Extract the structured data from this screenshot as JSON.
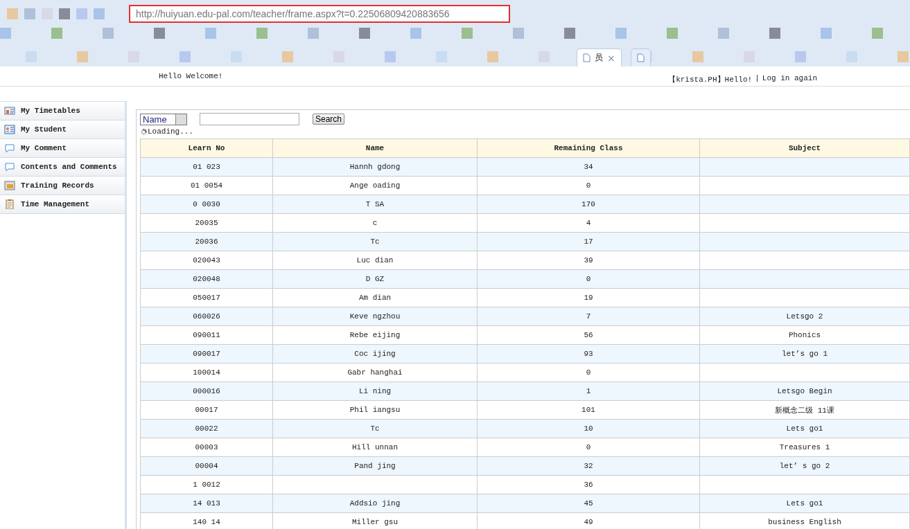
{
  "browser": {
    "address": "http://huiyuan.edu-pal.com/teacher/frame.aspx?t=0.22506809420883656",
    "tabs": [
      {
        "label": "员",
        "close": "×",
        "selected": true
      },
      {
        "selected": false
      }
    ]
  },
  "header": {
    "welcome": "Hello Welcome!",
    "user": "【krista.PH】Hello!",
    "separator": "|",
    "logout": "Log in again"
  },
  "sidebar": {
    "items": [
      {
        "label": "My Timetables",
        "kind": "timetable"
      },
      {
        "label": "My Student",
        "kind": "card"
      },
      {
        "label": "My Comment",
        "kind": "bubble"
      },
      {
        "label": "Contents and Comments",
        "kind": "bubble"
      },
      {
        "label": "Training Records",
        "kind": "records"
      },
      {
        "label": "Time Management",
        "kind": "clipboard"
      }
    ]
  },
  "search": {
    "field": "Name",
    "button": "Search",
    "status": "Loading..."
  },
  "table": {
    "columns": [
      "Learn No",
      "Name",
      "Remaining Class",
      "Subject"
    ],
    "rows": [
      [
        "01 023",
        "Hannh gdong",
        "34",
        ""
      ],
      [
        "01 0054",
        "Ange oading",
        "0",
        ""
      ],
      [
        "0 0030",
        "T SA",
        "170",
        ""
      ],
      [
        "20035",
        "c",
        "4",
        ""
      ],
      [
        "20036",
        "Tc",
        "17",
        ""
      ],
      [
        "020043",
        "Luc dian",
        "39",
        ""
      ],
      [
        "020048",
        "D GZ",
        "0",
        ""
      ],
      [
        "050017",
        "Am dian",
        "19",
        ""
      ],
      [
        "060026",
        "Keve ngzhou",
        "7",
        "Letsgo 2"
      ],
      [
        "090011",
        "Rebe eijing",
        "56",
        "Phonics"
      ],
      [
        "090017",
        "Coc ijing",
        "93",
        "let’s go 1"
      ],
      [
        "100014",
        "Gabr hanghai",
        "0",
        ""
      ],
      [
        "000016",
        "Li ning",
        "1",
        "Letsgo Begin"
      ],
      [
        "00017",
        "Phil iangsu",
        "101",
        "新概念二级 11课"
      ],
      [
        "00022",
        "Tc",
        "10",
        "Lets go1"
      ],
      [
        "00003",
        "Hill unnan",
        "0",
        "Treasures 1"
      ],
      [
        "00004",
        "Pand jing",
        "32",
        "let’ s go 2"
      ],
      [
        "1 0012",
        "",
        "36",
        ""
      ],
      [
        "14 013",
        "Addsio jing",
        "45",
        "Lets go1"
      ],
      [
        "140 14",
        "Miller gsu",
        "49",
        "business English"
      ]
    ]
  }
}
